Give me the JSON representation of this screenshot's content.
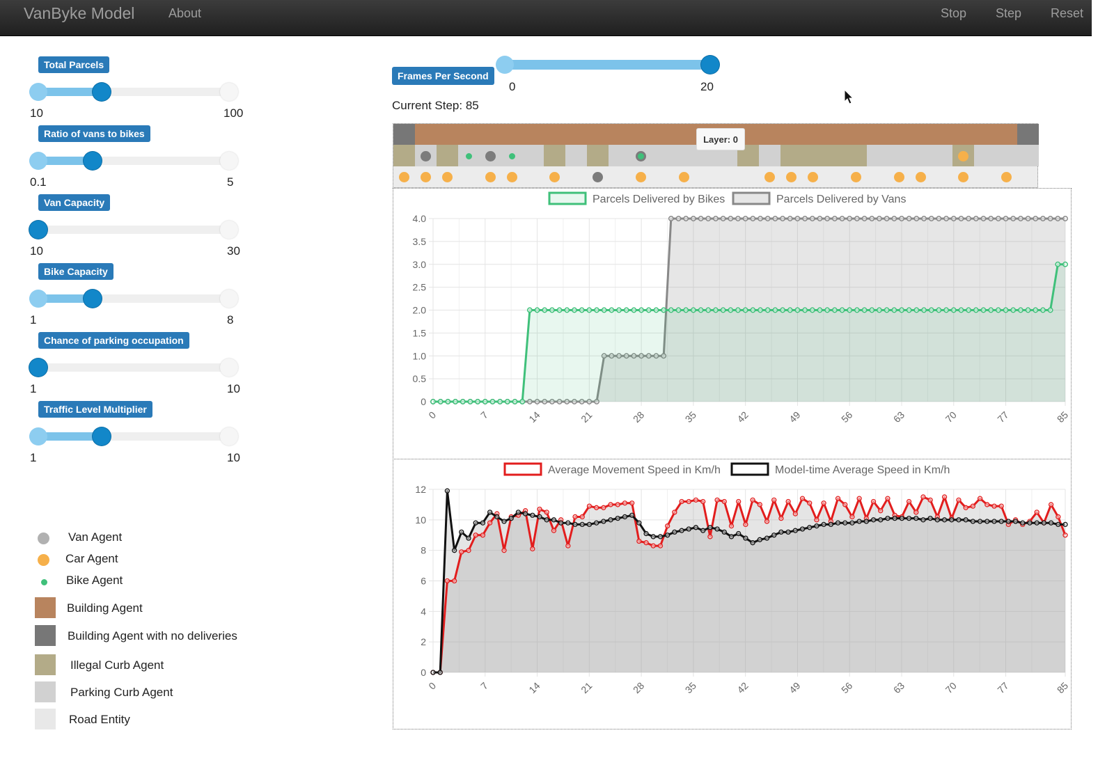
{
  "navbar": {
    "brand": "VanByke Model",
    "about": "About",
    "stop": "Stop",
    "step": "Step",
    "reset": "Reset"
  },
  "params": [
    {
      "label": "Total Parcels",
      "min": "10",
      "max": "100",
      "value": 40,
      "lo": 10,
      "hi": 100
    },
    {
      "label": "Ratio of vans to bikes",
      "min": "0.1",
      "max": "5",
      "value": 1.5,
      "lo": 0.1,
      "hi": 5
    },
    {
      "label": "Van Capacity",
      "min": "10",
      "max": "30",
      "value": 10,
      "lo": 10,
      "hi": 30
    },
    {
      "label": "Bike Capacity",
      "min": "1",
      "max": "8",
      "value": 3,
      "lo": 1,
      "hi": 8
    },
    {
      "label": "Chance of parking occupation",
      "min": "1",
      "max": "10",
      "value": 1,
      "lo": 1,
      "hi": 10
    },
    {
      "label": "Traffic Level Multiplier",
      "min": "1",
      "max": "10",
      "value": 4,
      "lo": 1,
      "hi": 10
    }
  ],
  "fps": {
    "label": "Frames Per Second",
    "min": "0",
    "max": "20",
    "value": 20
  },
  "current_step": "Current Step: 85",
  "tooltip": "Layer: 0",
  "legend": [
    {
      "label": "Van Agent",
      "kind": "dot",
      "color": "#b1b1b1",
      "icon": "van-agent-icon"
    },
    {
      "label": "Car Agent",
      "kind": "dot",
      "color": "#f6b04a",
      "icon": "car-agent-icon"
    },
    {
      "label": "Bike Agent",
      "kind": "smalldot",
      "color": "#3fc07a",
      "icon": "bike-agent-icon"
    },
    {
      "label": "Building Agent",
      "kind": "square",
      "color": "#b8845e",
      "icon": "building-agent-icon"
    },
    {
      "label": "Building Agent with no deliveries",
      "kind": "square",
      "color": "#777777",
      "icon": "building-no-deliveries-icon"
    },
    {
      "label": "Illegal Curb Agent",
      "kind": "square",
      "color": "#b3ab88",
      "icon": "illegal-curb-icon"
    },
    {
      "label": "Parking Curb Agent",
      "kind": "square",
      "color": "#d1d1d1",
      "icon": "parking-curb-icon"
    },
    {
      "label": "Road Entity",
      "kind": "square",
      "color": "#e8e8e8",
      "icon": "road-entity-icon"
    }
  ],
  "colors": {
    "building": "#b8845e",
    "building_empty": "#777777",
    "illegal_curb": "#b3ab88",
    "parking_curb": "#d1d1d1",
    "road": "#e8e8e8",
    "van": "#7c7c7c",
    "car": "#f6b04a",
    "bike": "#3fc07a"
  },
  "grid": {
    "row0": "XBBBBBBBBBBBBBBBBBBBBBBBBBBBBX",
    "row1": "IPIPPPPIPIPPPPPPIPIIIIPPPPIPPP",
    "row1_agents": [
      [
        1,
        "van"
      ],
      [
        3,
        "bike"
      ],
      [
        4,
        "van"
      ],
      [
        5,
        "bike"
      ],
      [
        11,
        "vanbike"
      ],
      [
        26,
        "car"
      ]
    ],
    "row2_cars": [
      0,
      1,
      2,
      4,
      5,
      7,
      11,
      13,
      17,
      18,
      19,
      21,
      23,
      24,
      26,
      28
    ],
    "row2_vans": [
      9
    ]
  },
  "chart_data": [
    {
      "type": "area",
      "x": [
        0,
        1,
        2,
        3,
        4,
        5,
        6,
        7,
        8,
        9,
        10,
        11,
        12,
        13,
        14,
        15,
        16,
        17,
        18,
        19,
        20,
        21,
        22,
        23,
        24,
        25,
        26,
        27,
        28,
        29,
        30,
        31,
        32,
        33,
        34,
        35,
        36,
        37,
        38,
        39,
        40,
        41,
        42,
        43,
        44,
        45,
        46,
        47,
        48,
        49,
        50,
        51,
        52,
        53,
        54,
        55,
        56,
        57,
        58,
        59,
        60,
        61,
        62,
        63,
        64,
        65,
        66,
        67,
        68,
        69,
        70,
        71,
        72,
        73,
        74,
        75,
        76,
        77,
        78,
        79,
        80,
        81,
        82,
        83,
        84,
        85
      ],
      "xticks": [
        0,
        7,
        14,
        21,
        28,
        35,
        42,
        49,
        56,
        63,
        70,
        77,
        85
      ],
      "yticks": [
        0,
        0.5,
        1.0,
        1.5,
        2.0,
        2.5,
        3.0,
        3.5,
        4.0
      ],
      "ytick_labels": [
        "0",
        "0.5",
        "1.0",
        "1.5",
        "2.0",
        "2.5",
        "3.0",
        "3.5",
        "4.0"
      ],
      "ylim": [
        0,
        4
      ],
      "series": [
        {
          "name": "Parcels Delivered by Bikes",
          "color": "#3fc07a",
          "fill": "rgba(63,192,122,0.12)",
          "breaks": [
            [
              13,
              2
            ],
            [
              84,
              3
            ]
          ]
        },
        {
          "name": "Parcels Delivered by Vans",
          "color": "#888888",
          "fill": "rgba(140,140,140,0.22)",
          "breaks": [
            [
              23,
              1
            ],
            [
              32,
              4
            ]
          ]
        }
      ]
    },
    {
      "type": "area",
      "xticks": [
        0,
        7,
        14,
        21,
        28,
        35,
        42,
        49,
        56,
        63,
        70,
        77,
        85
      ],
      "yticks": [
        0,
        2,
        4,
        6,
        8,
        10,
        12
      ],
      "ytick_labels": [
        "0",
        "2",
        "4",
        "6",
        "8",
        "10",
        "12"
      ],
      "ylim": [
        0,
        12
      ],
      "series": [
        {
          "name": "Average Movement Speed in Km/h",
          "color": "#e21d1d",
          "values": [
            0,
            0,
            6,
            6,
            7.9,
            8,
            9,
            9,
            9.8,
            10.4,
            8.0,
            10.2,
            10.3,
            10.6,
            8.1,
            10.7,
            10.5,
            9.3,
            10.0,
            8.3,
            10.2,
            10.2,
            10.9,
            10.8,
            10.8,
            11.0,
            11.0,
            11.1,
            11.1,
            8.6,
            8.5,
            8.3,
            8.3,
            9.6,
            10.5,
            11.2,
            11.2,
            11.3,
            11.2,
            8.9,
            11.3,
            11.2,
            9.6,
            11.2,
            9.7,
            11.3,
            11.0,
            9.9,
            11.3,
            10.1,
            11.2,
            10.4,
            11.4,
            11.1,
            10.0,
            11.1,
            9.9,
            11.4,
            11.0,
            10.2,
            11.4,
            10.1,
            11.2,
            10.6,
            11.4,
            10.3,
            10.2,
            11.2,
            10.5,
            11.5,
            11.3,
            10.2,
            11.5,
            10.1,
            11.3,
            10.8,
            10.9,
            11.4,
            11.0,
            10.9,
            10.9,
            9.7,
            10.0,
            9.7,
            9.9,
            10.5,
            9.8,
            11.0,
            10.2,
            9.0
          ]
        },
        {
          "name": "Model-time Average Speed in Km/h",
          "color": "#111111",
          "values": [
            0,
            0,
            11.9,
            8.0,
            9.2,
            8.8,
            9.8,
            9.8,
            10.5,
            10.2,
            9.9,
            10.1,
            10.5,
            10.4,
            10.3,
            10.2,
            10.0,
            10.0,
            9.8,
            9.8,
            9.7,
            9.7,
            9.7,
            9.8,
            9.9,
            10.0,
            10.1,
            10.2,
            10.3,
            9.8,
            9.1,
            8.9,
            8.9,
            9.0,
            9.2,
            9.3,
            9.4,
            9.5,
            9.3,
            9.5,
            9.4,
            9.2,
            8.9,
            9.1,
            8.8,
            8.5,
            8.7,
            8.8,
            9.0,
            9.2,
            9.2,
            9.3,
            9.4,
            9.5,
            9.6,
            9.7,
            9.7,
            9.8,
            9.8,
            9.8,
            9.9,
            9.9,
            10.0,
            10.0,
            10.1,
            10.1,
            10.1,
            10.1,
            10.1,
            10.0,
            10.1,
            10.0,
            10.0,
            10.0,
            10.0,
            10.0,
            9.9,
            9.9,
            9.9,
            9.9,
            9.9,
            9.9,
            9.9,
            9.8,
            9.8,
            9.8,
            9.8,
            9.8,
            9.7,
            9.7
          ]
        }
      ]
    }
  ]
}
